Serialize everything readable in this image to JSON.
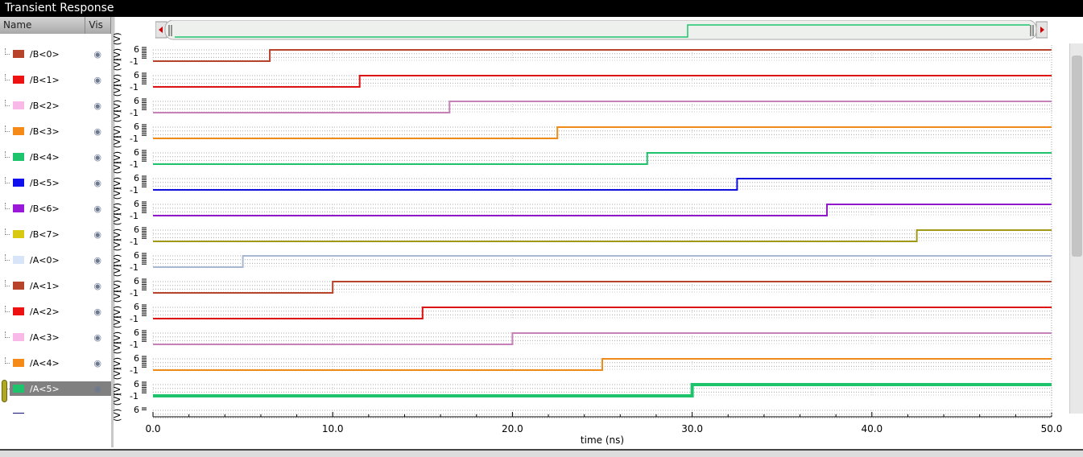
{
  "window": {
    "title": "Transient Response"
  },
  "columns": {
    "name": "Name",
    "vis": "Vis"
  },
  "xaxis": {
    "label": "time (ns)",
    "ticks": [
      "0.0",
      "10.0",
      "20.0",
      "30.0",
      "40.0",
      "50.0"
    ]
  },
  "yaxis": {
    "unit": "(V)",
    "max": "6",
    "min": "-1"
  },
  "chart_data": {
    "type": "line",
    "xlabel": "time (ns)",
    "xlim": [
      0,
      50
    ],
    "ylim": [
      -1,
      6
    ],
    "series": [
      {
        "name": "/B<0>",
        "color": "#b8432b",
        "line": "#b8432b",
        "step_at": 6.5
      },
      {
        "name": "/B<1>",
        "color": "#ee1111",
        "line": "#dd1111",
        "step_at": 11.5
      },
      {
        "name": "/B<2>",
        "color": "#f8b8e8",
        "line": "#c880b8",
        "step_at": 16.5
      },
      {
        "name": "/B<3>",
        "color": "#f58a18",
        "line": "#f08a18",
        "step_at": 22.5
      },
      {
        "name": "/B<4>",
        "color": "#1dc46c",
        "line": "#1dc46c",
        "step_at": 27.5
      },
      {
        "name": "/B<5>",
        "color": "#1010ee",
        "line": "#1010dd",
        "step_at": 32.5
      },
      {
        "name": "/B<6>",
        "color": "#9a18d8",
        "line": "#9018c8",
        "step_at": 37.5
      },
      {
        "name": "/B<7>",
        "color": "#d8c810",
        "line": "#a09818",
        "step_at": 42.5
      },
      {
        "name": "/A<0>",
        "color": "#d8e4f8",
        "line": "#a8b8d0",
        "step_at": 5
      },
      {
        "name": "/A<1>",
        "color": "#b8432b",
        "line": "#b8432b",
        "step_at": 10
      },
      {
        "name": "/A<2>",
        "color": "#ee1111",
        "line": "#dd1111",
        "step_at": 15
      },
      {
        "name": "/A<3>",
        "color": "#f8b8e8",
        "line": "#c880b8",
        "step_at": 20
      },
      {
        "name": "/A<4>",
        "color": "#f58a18",
        "line": "#f08a18",
        "step_at": 25
      },
      {
        "name": "/A<5>",
        "color": "#1dc46c",
        "line": "#1dc46c",
        "step_at": 30,
        "selected": true
      }
    ]
  }
}
